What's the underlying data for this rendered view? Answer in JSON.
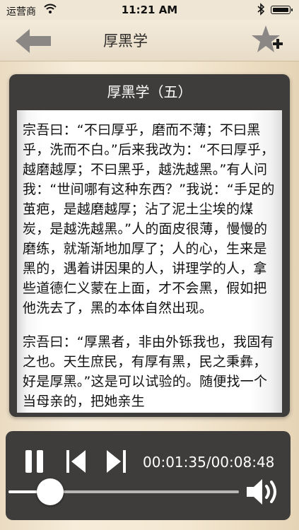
{
  "status_bar": {
    "carrier": "运营商",
    "time": "11:21 AM"
  },
  "nav": {
    "title": "厚黑学"
  },
  "reader": {
    "chapter_title": "厚黑学（五）",
    "paragraphs": [
      "宗吾曰：“不曰厚乎，磨而不薄；不曰黑乎，洗而不白。”后来我改为：“不曰厚乎，越磨越厚；不曰黑乎，越洗越黑。”有人问我：“世间哪有这种东西？”我说：“手足的茧疤，是越磨越厚；沾了泥土尘埃的煤炭，是越洗越黑。”人的面皮很薄，慢慢的磨练，就渐渐地加厚了；人的心，生来是黑的，遇着讲因果的人，讲理学的人，拿些道德仁义蒙在上面，才不会黑，假如把他洗去了，黑的本体自然出现。",
      "宗吾曰：“厚黑者，非由外铄我也，我固有之也。天生庶民，有厚有黑，民之秉彝，好是厚黑。”这是可以试验的。随便找一个当母亲的，把她亲生"
    ]
  },
  "player": {
    "time_display": "00:01:35/00:08:48",
    "progress_fraction": 0.18
  },
  "icons": {
    "back": "back-arrow-icon",
    "favorite": "add-favorite-star-icon",
    "pause": "pause-icon",
    "prev": "previous-track-icon",
    "next": "next-track-icon",
    "volume": "volume-icon"
  }
}
